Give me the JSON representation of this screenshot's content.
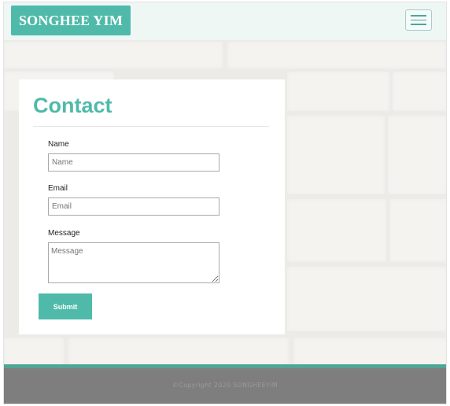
{
  "navbar": {
    "brand": "SONGHEE YIM",
    "toggle_icon": "hamburger-icon",
    "brand_color": "#4fbaa9"
  },
  "contact": {
    "title": "Contact",
    "name_label": "Name",
    "name_placeholder": "Name",
    "email_label": "Email",
    "email_placeholder": "Email",
    "message_label": "Message",
    "message_placeholder": "Message",
    "submit_label": "Submit"
  },
  "footer": {
    "copyright": "©Copyright 2020 SONGHEEYIM",
    "accent_color": "#4fa697"
  }
}
